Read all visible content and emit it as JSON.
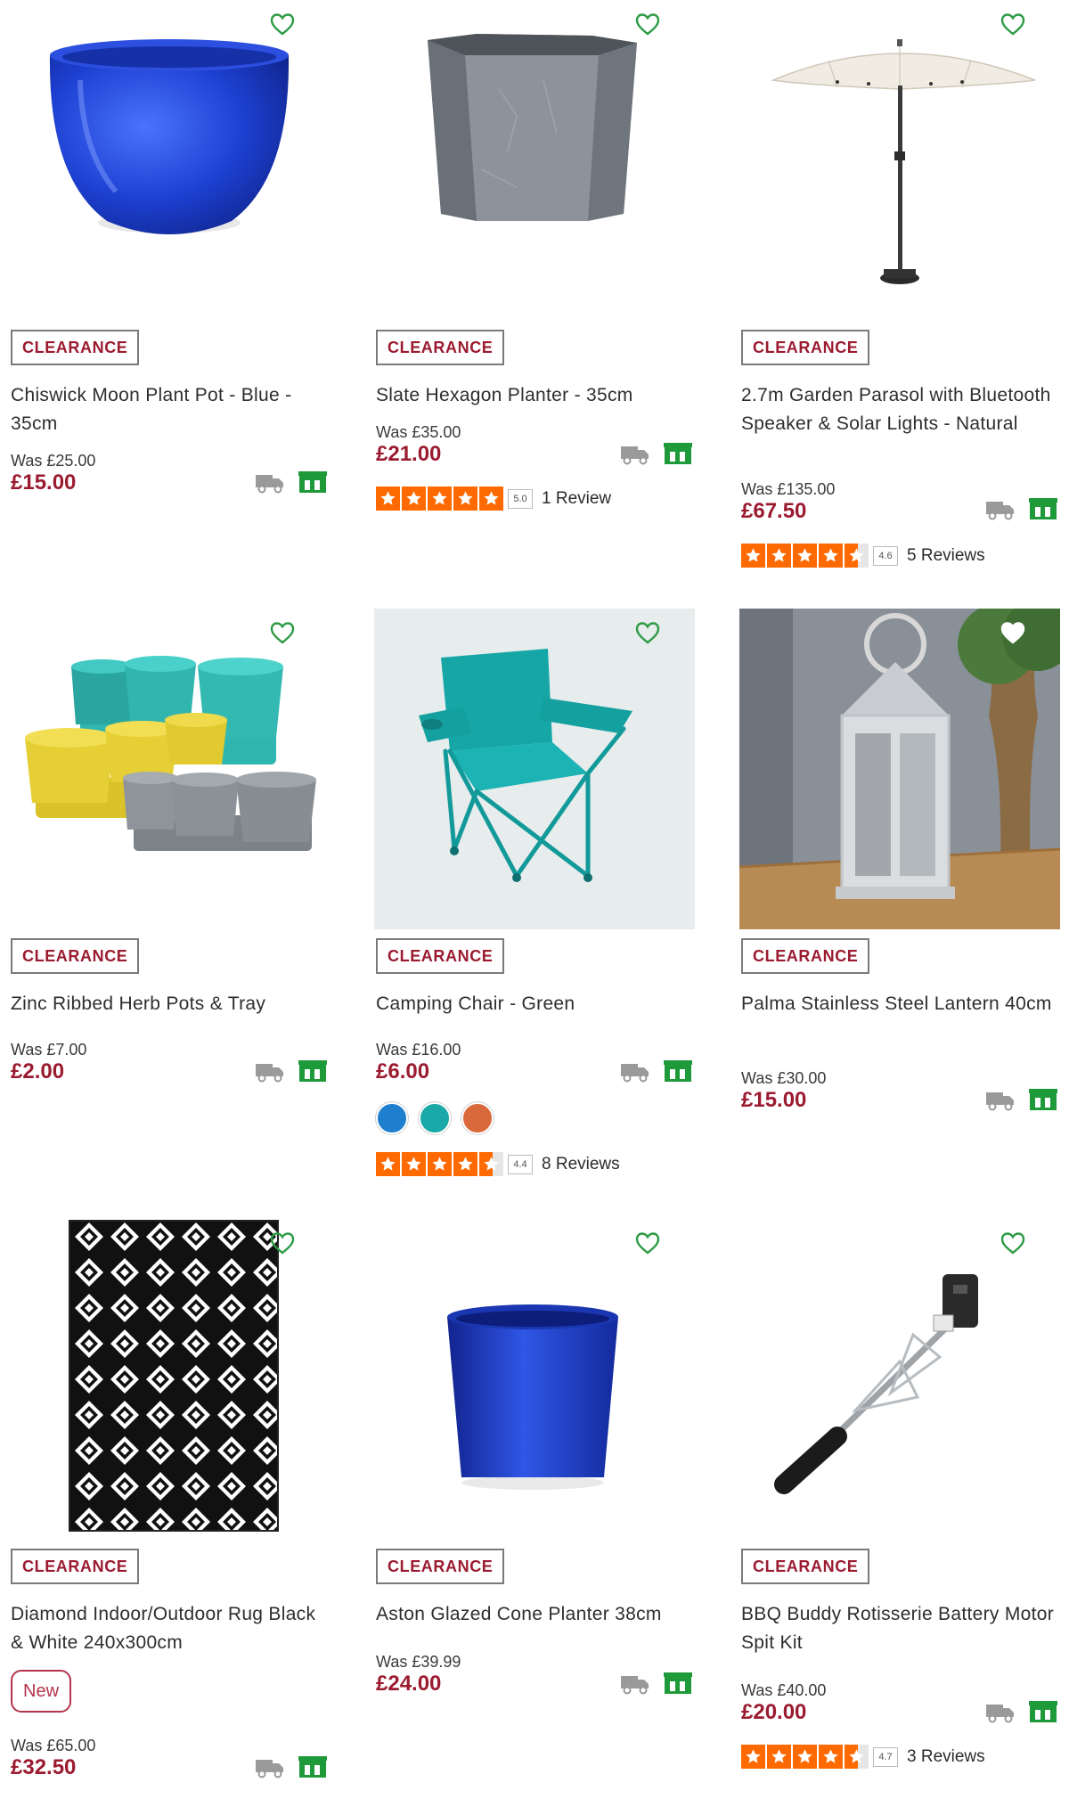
{
  "colors": {
    "accent": "#9b1b30",
    "heart": "#2e9b46",
    "star": "#ff6a00",
    "delivery": "#9a9a9a",
    "store": "#1f9a3a"
  },
  "icons": {
    "wishlist": "heart-outline-icon",
    "wishlist_filled": "heart-filled-icon",
    "delivery": "delivery-truck-icon",
    "store": "click-collect-store-icon",
    "star": "star-icon"
  },
  "products": [
    {
      "badge": "CLEARANCE",
      "title": "Chiswick Moon Plant Pot - Blue - 35cm",
      "was": "Was £25.00",
      "price": "£15.00"
    },
    {
      "badge": "CLEARANCE",
      "title": "Slate Hexagon Planter - 35cm",
      "was": "Was £35.00",
      "price": "£21.00",
      "rating": {
        "value": 5.0,
        "score": "5.0",
        "reviews": "1 Review"
      }
    },
    {
      "badge": "CLEARANCE",
      "title": "2.7m Garden Parasol with Bluetooth Speaker & Solar Lights - Natural",
      "was": "Was £135.00",
      "price": "£67.50",
      "rating": {
        "value": 4.6,
        "score": "4.6",
        "reviews": "5 Reviews"
      }
    },
    {
      "badge": "CLEARANCE",
      "title": "Zinc Ribbed Herb Pots & Tray",
      "was": "Was £7.00",
      "price": "£2.00"
    },
    {
      "badge": "CLEARANCE",
      "title": "Camping Chair - Green",
      "was": "Was £16.00",
      "price": "£6.00",
      "swatches": [
        "#1e7fcf",
        "#1aa8a8",
        "#d9693a"
      ],
      "rating": {
        "value": 4.4,
        "score": "4.4",
        "reviews": "8 Reviews"
      }
    },
    {
      "badge": "CLEARANCE",
      "title": "Palma Stainless Steel Lantern 40cm",
      "was": "Was £30.00",
      "price": "£15.00",
      "wishlisted": true
    },
    {
      "badge": "CLEARANCE",
      "title": "Diamond Indoor/Outdoor Rug Black & White 240x300cm",
      "was": "Was £65.00",
      "price": "£32.50",
      "new_label": "New"
    },
    {
      "badge": "CLEARANCE",
      "title": "Aston Glazed Cone Planter 38cm",
      "was": "Was £39.99",
      "price": "£24.00"
    },
    {
      "badge": "CLEARANCE",
      "title": "BBQ Buddy Rotisserie Battery Motor Spit Kit",
      "was": "Was £40.00",
      "price": "£20.00",
      "rating": {
        "value": 4.7,
        "score": "4.7",
        "reviews": "3 Reviews"
      }
    }
  ]
}
